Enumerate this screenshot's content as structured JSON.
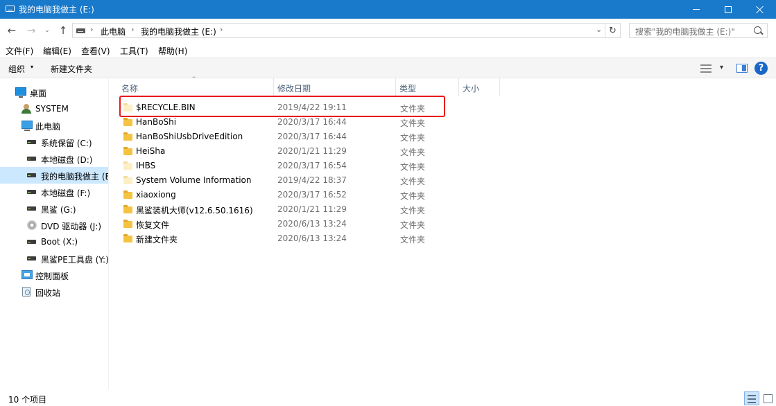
{
  "window": {
    "title": "我的电脑我做主 (E:)",
    "accent_color": "#1979ca"
  },
  "address": {
    "crumbs": [
      "此电脑",
      "我的电脑我做主 (E:)"
    ],
    "separator": "›"
  },
  "search": {
    "placeholder": "搜索\"我的电脑我做主 (E:)\""
  },
  "menu": [
    "文件(F)",
    "编辑(E)",
    "查看(V)",
    "工具(T)",
    "帮助(H)"
  ],
  "commands": {
    "organize": "组织",
    "new_folder": "新建文件夹"
  },
  "icons": {
    "back": "back-arrow-icon",
    "forward": "forward-arrow-icon",
    "up": "up-arrow-icon",
    "refresh": "refresh-icon",
    "search": "search-icon",
    "help": "help-icon",
    "folder": "folder-icon",
    "drive": "drive-icon"
  },
  "glyphs": {
    "back": "←",
    "forward": "→",
    "recent": "⌄",
    "up": "↑",
    "dropdown": "⌄",
    "refresh": "↻",
    "caret": "▾",
    "sort_up": "^",
    "help": "?"
  },
  "sidebar": {
    "items": [
      {
        "label": "桌面",
        "icon": "desktop-icon"
      },
      {
        "label": "SYSTEM",
        "icon": "user-icon"
      },
      {
        "label": "此电脑",
        "icon": "this-pc-icon"
      },
      {
        "label": "系统保留 (C:)",
        "icon": "drive-icon"
      },
      {
        "label": "本地磁盘 (D:)",
        "icon": "drive-icon"
      },
      {
        "label": "我的电脑我做主 (E:)",
        "icon": "drive-icon",
        "selected": true
      },
      {
        "label": "本地磁盘 (F:)",
        "icon": "drive-icon"
      },
      {
        "label": "黑鲨 (G:)",
        "icon": "drive-icon"
      },
      {
        "label": "DVD 驱动器 (J:)",
        "icon": "dvd-icon"
      },
      {
        "label": "Boot (X:)",
        "icon": "drive-icon"
      },
      {
        "label": "黑鲨PE工具盘 (Y:)",
        "icon": "drive-icon"
      },
      {
        "label": "控制面板",
        "icon": "control-panel-icon"
      },
      {
        "label": "回收站",
        "icon": "recycle-bin-icon"
      }
    ]
  },
  "columns": [
    "名称",
    "修改日期",
    "类型",
    "大小"
  ],
  "files": [
    {
      "name": "$RECYCLE.BIN",
      "date": "2019/4/22 19:11",
      "type": "文件夹",
      "pale": true
    },
    {
      "name": "HanBoShi",
      "date": "2020/3/17 16:44",
      "type": "文件夹",
      "pale": false
    },
    {
      "name": "HanBoShiUsbDriveEdition",
      "date": "2020/3/17 16:44",
      "type": "文件夹",
      "pale": false
    },
    {
      "name": "HeiSha",
      "date": "2020/1/21 11:29",
      "type": "文件夹",
      "pale": false
    },
    {
      "name": "IHBS",
      "date": "2020/3/17 16:54",
      "type": "文件夹",
      "pale": true
    },
    {
      "name": "System Volume Information",
      "date": "2019/4/22 18:37",
      "type": "文件夹",
      "pale": true
    },
    {
      "name": "xiaoxiong",
      "date": "2020/3/17 16:52",
      "type": "文件夹",
      "pale": false
    },
    {
      "name": "黑鲨装机大师(v12.6.50.1616)",
      "date": "2020/1/21 11:29",
      "type": "文件夹",
      "pale": false
    },
    {
      "name": "恢复文件",
      "date": "2020/6/13 13:24",
      "type": "文件夹",
      "pale": false
    },
    {
      "name": "新建文件夹",
      "date": "2020/6/13 13:24",
      "type": "文件夹",
      "pale": false
    }
  ],
  "highlight_color": "#e8181c",
  "status": {
    "count": "10 个项目"
  }
}
